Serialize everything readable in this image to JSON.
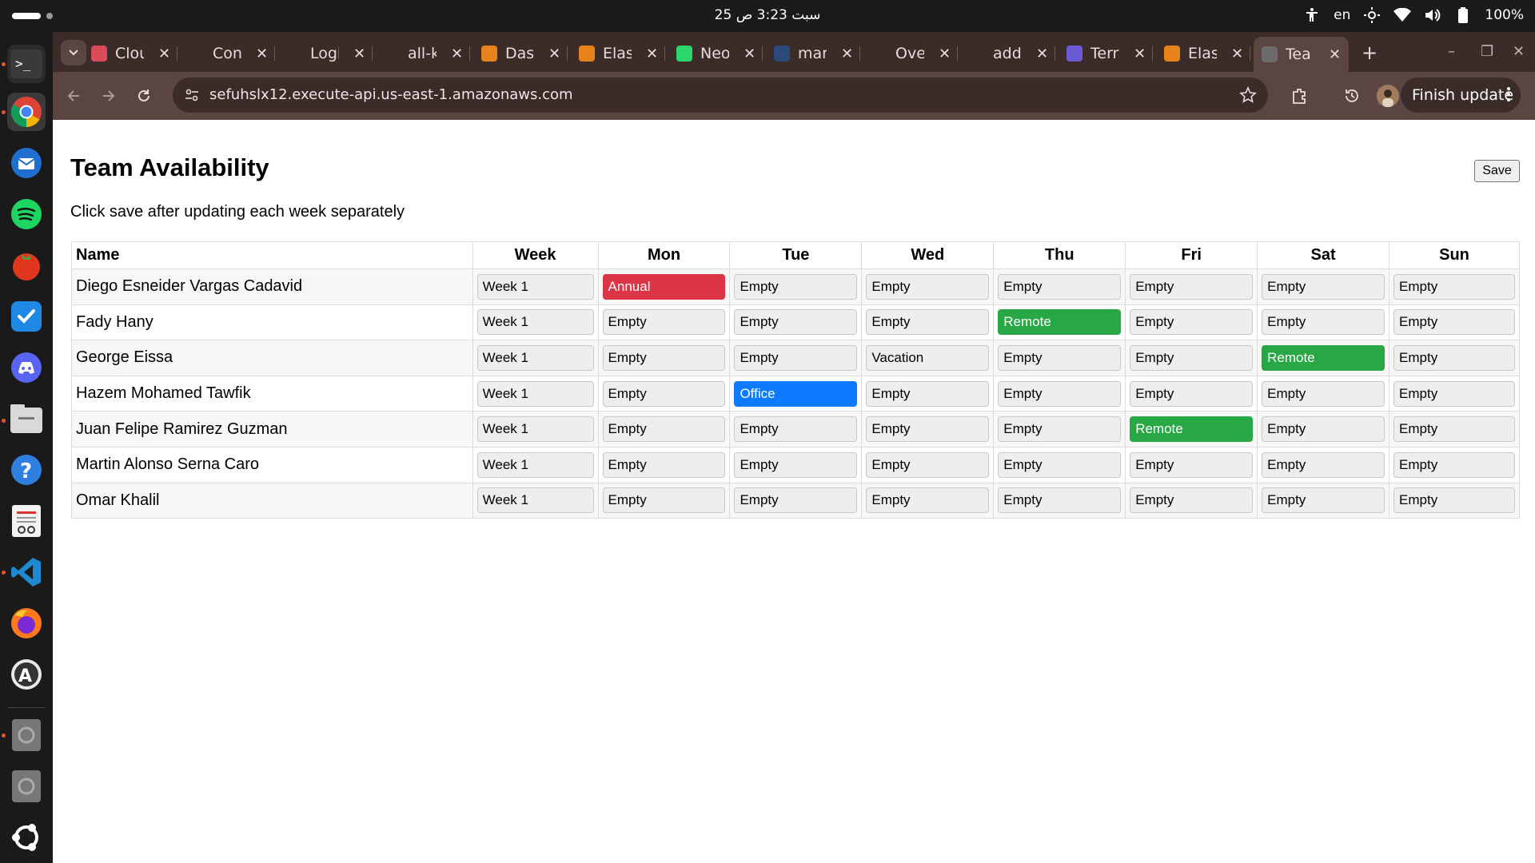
{
  "system": {
    "clock": "25 سبت  3:23 ص",
    "language": "en",
    "battery": "100%"
  },
  "browser": {
    "tabs": [
      {
        "title": "Clou",
        "icon": "cloudinary-icon",
        "color": "#d94a5a"
      },
      {
        "title": "Con",
        "icon": "openai-icon",
        "color": "#3a2b29"
      },
      {
        "title": "Logi",
        "icon": "slack-icon",
        "color": "#3a2b29"
      },
      {
        "title": "all-k",
        "icon": "slack-icon",
        "color": "#3a2b29"
      },
      {
        "title": "Das",
        "icon": "aws-lambda-icon",
        "color": "#e8821a"
      },
      {
        "title": "Elas",
        "icon": "aws-icon",
        "color": "#e8821a"
      },
      {
        "title": "Neo",
        "icon": "neon-icon",
        "color": "#2bd66b"
      },
      {
        "title": "mar",
        "icon": "docker-icon",
        "color": "#2a4a7a"
      },
      {
        "title": "Ove",
        "icon": "render-icon",
        "color": "#3a2b29"
      },
      {
        "title": "add",
        "icon": "github-icon",
        "color": "#3a2b29"
      },
      {
        "title": "Terr",
        "icon": "terraform-icon",
        "color": "#6b5bd6"
      },
      {
        "title": "Elas",
        "icon": "aws-icon",
        "color": "#e8821a"
      },
      {
        "title": "Tea",
        "icon": "globe-icon",
        "color": "#6b6b6b",
        "active": true
      }
    ],
    "url": "sefuhslx12.execute-api.us-east-1.amazonaws.com",
    "finish_update": "Finish update"
  },
  "page": {
    "title": "Team Availability",
    "subtitle": "Click save after updating each week separately",
    "save_label": "Save",
    "headers": [
      "Name",
      "Week",
      "Mon",
      "Tue",
      "Wed",
      "Thu",
      "Fri",
      "Sat",
      "Sun"
    ],
    "rows": [
      {
        "name": "Diego Esneider Vargas Cadavid",
        "week": "Week 1",
        "days": [
          "Annual",
          "Empty",
          "Empty",
          "Empty",
          "Empty",
          "Empty",
          "Empty"
        ]
      },
      {
        "name": "Fady Hany",
        "week": "Week 1",
        "days": [
          "Empty",
          "Empty",
          "Empty",
          "Remote",
          "Empty",
          "Empty",
          "Empty"
        ]
      },
      {
        "name": "George Eissa",
        "week": "Week 1",
        "days": [
          "Empty",
          "Empty",
          "Vacation",
          "Empty",
          "Empty",
          "Remote",
          "Empty"
        ]
      },
      {
        "name": "Hazem Mohamed Tawfik",
        "week": "Week 1",
        "days": [
          "Empty",
          "Office",
          "Empty",
          "Empty",
          "Empty",
          "Empty",
          "Empty"
        ]
      },
      {
        "name": "Juan Felipe Ramirez Guzman",
        "week": "Week 1",
        "days": [
          "Empty",
          "Empty",
          "Empty",
          "Empty",
          "Remote",
          "Empty",
          "Empty"
        ]
      },
      {
        "name": "Martin Alonso Serna Caro",
        "week": "Week 1",
        "days": [
          "Empty",
          "Empty",
          "Empty",
          "Empty",
          "Empty",
          "Empty",
          "Empty"
        ]
      },
      {
        "name": "Omar Khalil",
        "week": "Week 1",
        "days": [
          "Empty",
          "Empty",
          "Empty",
          "Empty",
          "Empty",
          "Empty",
          "Empty"
        ]
      }
    ],
    "status_colors": {
      "Annual": "#dc3545",
      "Remote": "#28a745",
      "Office": "#0d7bff",
      "Empty": "#eeeeee",
      "Vacation": "#eeeeee"
    }
  }
}
